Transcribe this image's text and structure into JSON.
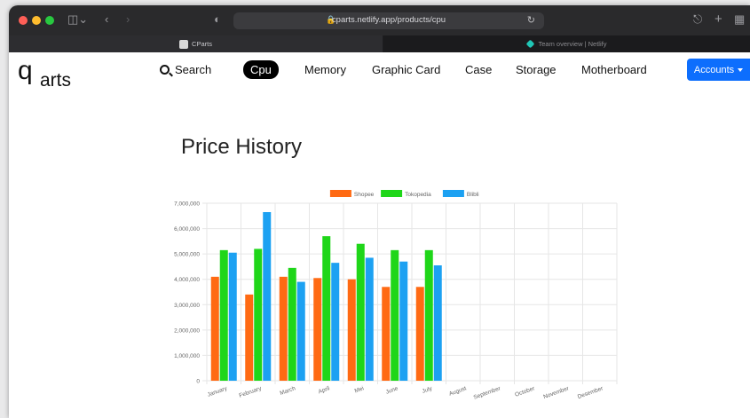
{
  "browser": {
    "url": "cparts.netlify.app/products/cpu",
    "tabs": [
      {
        "label": "CParts",
        "active": true
      },
      {
        "label": "Team overview | Netlify",
        "active": false
      }
    ]
  },
  "brand": {
    "logo_main": "q",
    "logo_rest": "arts"
  },
  "nav": {
    "search": "Search",
    "items": [
      "Cpu",
      "Memory",
      "Graphic Card",
      "Case",
      "Storage",
      "Motherboard"
    ],
    "active": "Cpu",
    "accounts": "Accounts"
  },
  "colors": {
    "accent": "#0d6efd",
    "shopee": "#ff6a13",
    "tokopedia": "#1fd619",
    "blibli": "#1ca1f2"
  },
  "page": {
    "title": "Price History"
  },
  "chart_data": {
    "type": "bar",
    "categories": [
      "January",
      "February",
      "March",
      "April",
      "Mei",
      "June",
      "July",
      "August",
      "September",
      "October",
      "November",
      "Desember"
    ],
    "series": [
      {
        "name": "Shopee",
        "color": "#ff6a13",
        "values": [
          4100000,
          3400000,
          4100000,
          4050000,
          4000000,
          3700000,
          3700000,
          null,
          null,
          null,
          null,
          null
        ]
      },
      {
        "name": "Tokopedia",
        "color": "#1fd619",
        "values": [
          5150000,
          5200000,
          4450000,
          5700000,
          5400000,
          5150000,
          5150000,
          null,
          null,
          null,
          null,
          null
        ]
      },
      {
        "name": "Blibli",
        "color": "#1ca1f2",
        "values": [
          5050000,
          6650000,
          3900000,
          4650000,
          4850000,
          4700000,
          4550000,
          null,
          null,
          null,
          null,
          null
        ]
      }
    ],
    "yticks": [
      "0",
      "1,000,000",
      "2,000,000",
      "3,000,000",
      "4,000,000",
      "5,000,000",
      "6,000,000",
      "7,000,000"
    ],
    "ylim": [
      0,
      7000000
    ],
    "legend_position": "top",
    "grid": true
  }
}
